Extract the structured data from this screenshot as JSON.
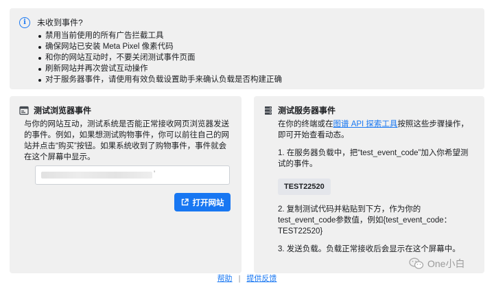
{
  "tips": {
    "title": "未收到事件?",
    "items": [
      "禁用当前使用的所有广告拦截工具",
      "确保网站已安装 Meta Pixel 像素代码",
      "和你的网站互动时，不要关闭测试事件页面",
      "刷新网站并再次尝试互动操作",
      "对于服务器事件，请使用有效负载设置助手来确认负载是否构建正确"
    ]
  },
  "browser": {
    "title": "测试浏览器事件",
    "description": "与你的网站互动，测试系统是否能正常接收网页浏览器发送的事件。例如，如果想测试购物事件，你可以前往自己的网站并点击“购买”按钮。如果系统收到了购物事件，事件就会在这个屏幕中显示。",
    "input_value": "'",
    "button_label": "打开网站"
  },
  "server": {
    "title": "测试服务器事件",
    "intro_before": "在你的终端或在",
    "intro_link": "图谱 API 探索工具",
    "intro_after": "按照这些步骤操作，即可开始查看动态。",
    "step1": "1. 在服务器负载中，把“test_event_code”加入你希望测试的事件。",
    "test_code": "TEST22520",
    "step2": "2. 复制测试代码并粘贴到下方，作为你的test_event_code参数值，例如{test_event_code：TEST22520}",
    "step3": "3. 发送负载。负载正常接收后会显示在这个屏幕中。"
  },
  "footer": {
    "help": "帮助",
    "separator": "|",
    "feedback": "提供反馈"
  },
  "watermark": {
    "text": "One小白",
    "icon": "wechat-icon"
  },
  "colors": {
    "accent": "#1877f2",
    "card_bg": "#f0f0f0"
  }
}
